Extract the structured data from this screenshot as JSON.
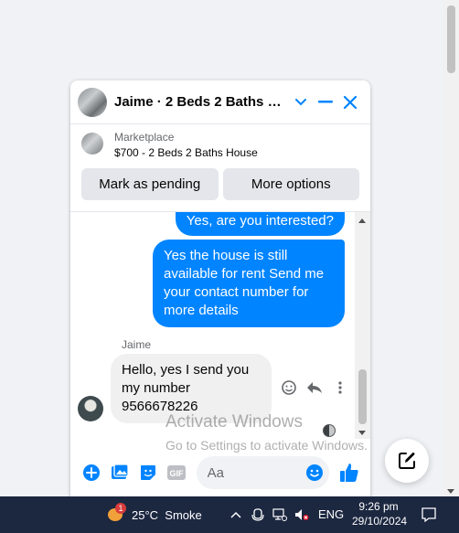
{
  "chat": {
    "title": "Jaime · 2 Beds 2 Baths Ho...",
    "marketplace_label": "Marketplace",
    "listing": "$700 - 2 Beds 2 Baths House",
    "mark_pending": "Mark as pending",
    "more_options": "More options",
    "messages": [
      {
        "from": "me",
        "text": "Yes, are you interested?"
      },
      {
        "from": "me",
        "text": "Yes the house is still available for rent Send me your contact number for more details"
      },
      {
        "from": "Jaime",
        "text": "Hello, yes I send you my number 9566678226"
      }
    ],
    "sender_name": "Jaime",
    "composer_placeholder": "Aa"
  },
  "watermark": {
    "line1": "Activate Windows",
    "line2": "Go to Settings to activate Windows."
  },
  "taskbar": {
    "weather_badge": "1",
    "weather": "25°C  Smoke",
    "language": "ENG",
    "time": "9:26 pm",
    "date": "29/10/2024"
  },
  "colors": {
    "accent": "#0084ff",
    "taskbar": "#1c2740"
  }
}
